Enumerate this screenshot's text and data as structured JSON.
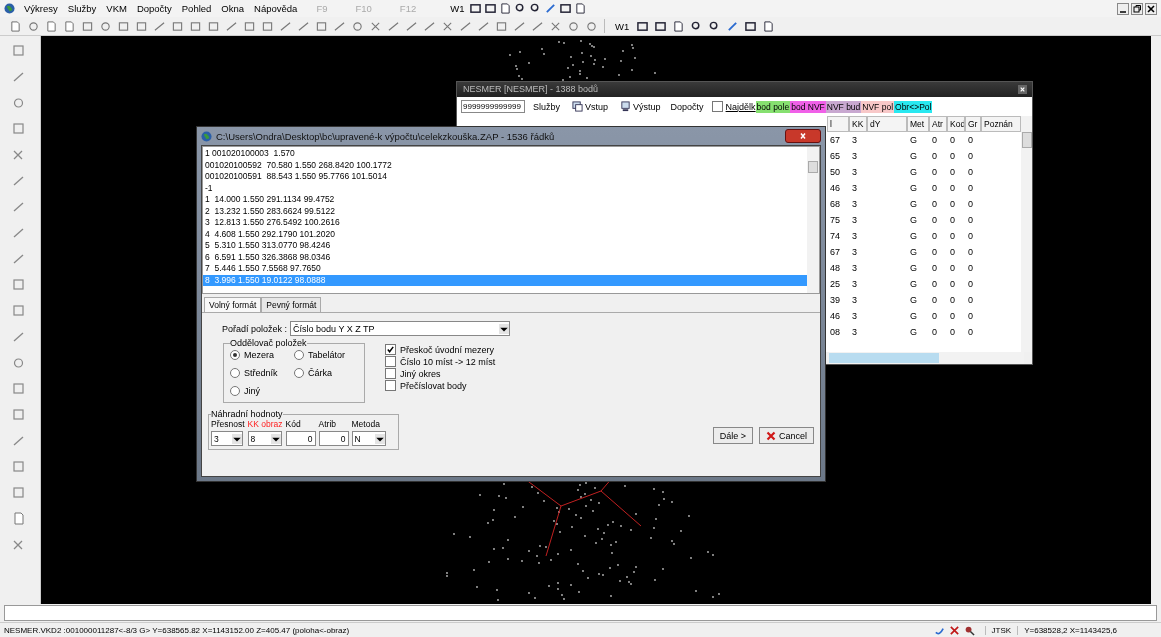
{
  "menu_bar": {
    "items": [
      "Výkresy",
      "Služby",
      "VKM",
      "Dopočty",
      "Pohled",
      "Okna",
      "Nápověda"
    ],
    "function_keys": [
      {
        "label": "F9",
        "disabled": true
      },
      {
        "label": "F10",
        "disabled": true
      },
      {
        "label": "F12",
        "disabled": true
      }
    ],
    "workspace": "W1"
  },
  "toolbar": {
    "workspace": "W1"
  },
  "dialog": {
    "title": "C:\\Users\\Ondra\\Desktop\\bc\\upravené-k výpočtu\\celekzkouška.ZAP - 1536 řádků",
    "lines": [
      {
        "text": "1 001020100003  1.570",
        "selected": false
      },
      {
        "text": "001020100592  70.580 1.550 268.8420 100.1772",
        "selected": false
      },
      {
        "text": "001020100591  88.543 1.550 95.7766 101.5014",
        "selected": false
      },
      {
        "text": "-1",
        "selected": false
      },
      {
        "text": "1  14.000 1.550 291.1134 99.4752",
        "selected": false
      },
      {
        "text": "2  13.232 1.550 283.6624 99.5122",
        "selected": false
      },
      {
        "text": "3  12.813 1.550 276.5492 100.2616",
        "selected": false
      },
      {
        "text": "4  4.608 1.550 292.1790 101.2020",
        "selected": false
      },
      {
        "text": "5  5.310 1.550 313.0770 98.4246",
        "selected": false
      },
      {
        "text": "6  6.591 1.550 326.3868 98.0346",
        "selected": false
      },
      {
        "text": "7  5.446 1.550 7.5568 97.7650",
        "selected": false
      },
      {
        "text": "8  3.996 1.550 19.0122 98.0888",
        "selected": true
      }
    ],
    "tabs": [
      {
        "label": "Volný formát",
        "selected": true
      },
      {
        "label": "Pevný formát",
        "selected": false
      }
    ],
    "order": {
      "label": "Pořadí položek :",
      "value": "Číslo bodu Y X Z TP"
    },
    "separator": {
      "title": "Oddělovač položek",
      "options": [
        {
          "label": "Mezera",
          "selected": true
        },
        {
          "label": "Tabelátor",
          "selected": false
        },
        {
          "label": "Středník",
          "selected": false
        },
        {
          "label": "Čárka",
          "selected": false
        },
        {
          "label": "Jiný",
          "selected": false
        }
      ]
    },
    "options": [
      {
        "label": "Přeskoč úvodní mezery",
        "checked": true
      },
      {
        "label": "Číslo 10 míst -> 12 míst",
        "checked": false
      },
      {
        "label": "Jiný okres",
        "checked": false
      },
      {
        "label": "Přečíslovat body",
        "checked": false
      }
    ],
    "defaults": {
      "title": "Náhradní hodnoty",
      "fields": [
        {
          "label": "Přesnost",
          "value": "3",
          "kind": "select",
          "highlight": false
        },
        {
          "label": "KK obraz",
          "value": "8",
          "kind": "select",
          "highlight": true
        },
        {
          "label": "Kód",
          "value": "0",
          "kind": "input",
          "highlight": false
        },
        {
          "label": "Atrib",
          "value": "0",
          "kind": "input",
          "highlight": false
        },
        {
          "label": "Metoda",
          "value": "N",
          "kind": "select",
          "highlight": false
        }
      ]
    },
    "buttons": [
      {
        "label": "Dále >",
        "kind": "next"
      },
      {
        "label": "Cancel",
        "kind": "cancel"
      }
    ]
  },
  "nesmer": {
    "title": "NESMER [NESMER] - 1388 bodů",
    "search": {
      "value": "9999999999999"
    },
    "toolbar": [
      {
        "label": "Služby",
        "kind": "menu"
      },
      {
        "label": "Vstup",
        "kind": "input"
      },
      {
        "label": "Výstup",
        "kind": "output"
      },
      {
        "label": "Dopočty",
        "kind": "menu"
      }
    ],
    "find": {
      "label": "Najdělk",
      "checked": false
    },
    "legend": [
      {
        "label": "bod pole",
        "color": "#86e070"
      },
      {
        "label": "bod NVF",
        "color": "#f060e8"
      },
      {
        "label": "NVF bud",
        "color": "#c8a8d0"
      },
      {
        "label": "NVF pol",
        "color": "#f8c8c8"
      },
      {
        "label": "Obr<>Pol",
        "color": "#28e8f0"
      }
    ],
    "table": {
      "columns": [
        "l",
        "KK",
        "dY",
        "Met",
        "Atr",
        "Kod",
        "Gr",
        "Poznán"
      ],
      "rows": [
        {
          "column_1": "67",
          "kk": "3",
          "met": "G",
          "atr": "0",
          "kod": "0",
          "gr": "0"
        },
        {
          "column_1": "65",
          "kk": "3",
          "met": "G",
          "atr": "0",
          "kod": "0",
          "gr": "0"
        },
        {
          "column_1": "50",
          "kk": "3",
          "met": "G",
          "atr": "0",
          "kod": "0",
          "gr": "0"
        },
        {
          "column_1": "46",
          "kk": "3",
          "met": "G",
          "atr": "0",
          "kod": "0",
          "gr": "0"
        },
        {
          "column_1": "68",
          "kk": "3",
          "met": "G",
          "atr": "0",
          "kod": "0",
          "gr": "0"
        },
        {
          "column_1": "75",
          "kk": "3",
          "met": "G",
          "atr": "0",
          "kod": "0",
          "gr": "0"
        },
        {
          "column_1": "74",
          "kk": "3",
          "met": "G",
          "atr": "0",
          "kod": "0",
          "gr": "0"
        },
        {
          "column_1": "67",
          "kk": "3",
          "met": "G",
          "atr": "0",
          "kod": "0",
          "gr": "0"
        },
        {
          "column_1": "48",
          "kk": "3",
          "met": "G",
          "atr": "0",
          "kod": "0",
          "gr": "0"
        },
        {
          "column_1": "25",
          "kk": "3",
          "met": "G",
          "atr": "0",
          "kod": "0",
          "gr": "0"
        },
        {
          "column_1": "39",
          "kk": "3",
          "met": "G",
          "atr": "0",
          "kod": "0",
          "gr": "0"
        },
        {
          "column_1": "46",
          "kk": "3",
          "met": "G",
          "atr": "0",
          "kod": "0",
          "gr": "0"
        },
        {
          "column_1": "08",
          "kk": "3",
          "met": "G",
          "atr": "0",
          "kod": "0",
          "gr": "0"
        }
      ]
    }
  },
  "status_bar": {
    "text": "NESMER.VKD2 :001000011287<-8/3 G> Y=638565.82 X=1143152.00 Z=405.47 (poloha<-obraz)",
    "projection": "JTSK",
    "coordinates": "Y=638528,2 X=1143425,6"
  }
}
